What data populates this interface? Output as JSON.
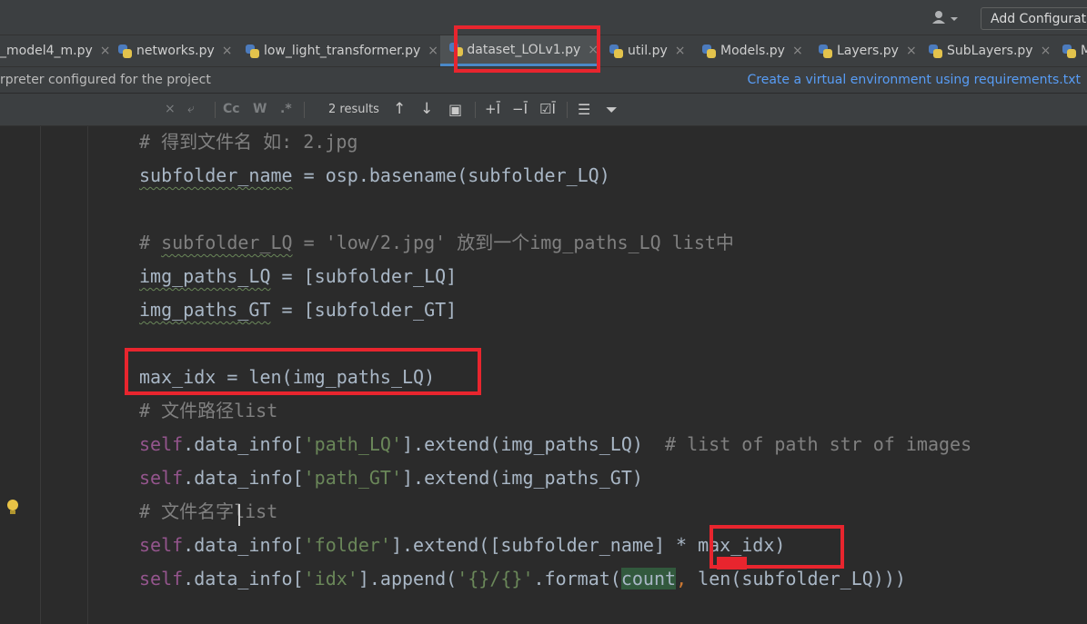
{
  "toolbar": {
    "user_icon": "user-dropdown-icon",
    "add_config_label": "Add Configuration..."
  },
  "tabs": [
    {
      "label": "_model4_m.py",
      "active": false
    },
    {
      "label": "networks.py",
      "active": false
    },
    {
      "label": "low_light_transformer.py",
      "active": false
    },
    {
      "label": "dataset_LOLv1.py",
      "active": true
    },
    {
      "label": "util.py",
      "active": false
    },
    {
      "label": "Models.py",
      "active": false
    },
    {
      "label": "Layers.py",
      "active": false
    },
    {
      "label": "SubLayers.py",
      "active": false
    },
    {
      "label": "M",
      "active": false
    }
  ],
  "banner": {
    "message": "rpreter configured for the project",
    "action": "Create a virtual environment using requirements.txt"
  },
  "find_bar": {
    "clear_glyph": "×",
    "replace_glyph": "⤶",
    "match_case": "Cc",
    "words": "W",
    "regex": ".*",
    "results": "2 results",
    "prev_glyph": "↑",
    "next_glyph": "↓",
    "in_selection_glyph": "▣",
    "add_cursor_glyph": "+Ī",
    "remove_cursor_glyph": "−Ī",
    "select_all_glyph": "☑Ī",
    "options_glyph": "☰",
    "filter_glyph": "⏷"
  },
  "code": {
    "l1": "# 得到文件名 如: 2.jpg",
    "l2_a": "subfolder_name",
    "l2_b": " = osp.basename(subfolder_LQ)",
    "l3_a": "# ",
    "l3_b": "subfolder_LQ",
    "l3_c": " = 'low/2.jpg' 放到一个img_paths_LQ list中",
    "l4_a": "img_paths_LQ",
    "l4_b": " = [subfolder_LQ]",
    "l5_a": "img_paths_GT",
    "l5_b": " = [subfolder_GT]",
    "l6": "max_idx = len(img_paths_LQ)",
    "l7": "# 文件路径list",
    "l8_self": "self",
    "l8_a": ".data_info[",
    "l8_str": "'path_LQ'",
    "l8_b": "].extend(img_paths_LQ)  ",
    "l8_comment": "# list of path str of images",
    "l9_self": "self",
    "l9_a": ".data_info[",
    "l9_str": "'path_GT'",
    "l9_b": "].extend(img_paths_GT)",
    "l10": "# 文件名字list",
    "l11_self": "self",
    "l11_a": ".data_info[",
    "l11_str": "'folder'",
    "l11_b": "].extend([subfolder_name] * max_idx)",
    "l12_self": "self",
    "l12_a": ".data_info[",
    "l12_str": "'idx'",
    "l12_b": "].append(",
    "l12_str2": "'{}/{}'",
    "l12_c": ".format(",
    "l12_count": "count",
    "l12_comma": ",",
    "l12_d": " len(subfolder_LQ)))"
  },
  "colors": {
    "editor_bg": "#2b2b2b",
    "panel_bg": "#3c3f41",
    "keyword_self": "#94558d",
    "string": "#6a8759",
    "comment": "#808080",
    "annotation_red": "#e8252e",
    "link_blue": "#589df6"
  }
}
